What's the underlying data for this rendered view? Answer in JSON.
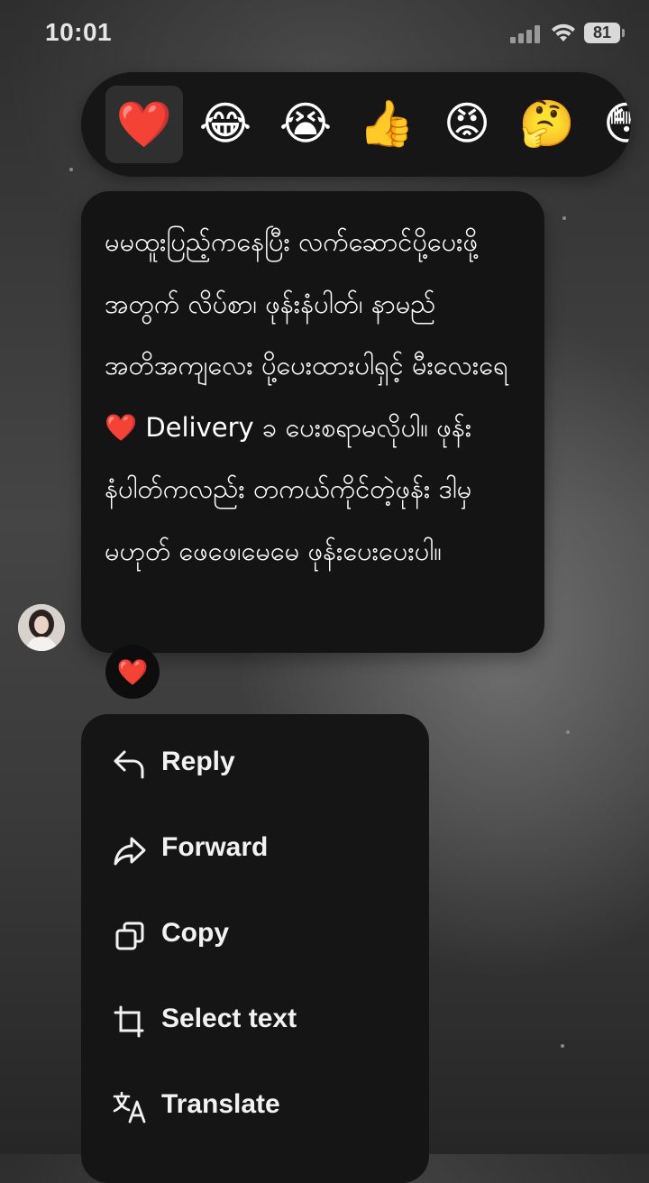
{
  "status_bar": {
    "time": "10:01",
    "battery": "81"
  },
  "reactions": [
    {
      "emoji": "❤️",
      "name": "heart",
      "selected": true
    },
    {
      "emoji": "😂",
      "name": "laughing"
    },
    {
      "emoji": "😭",
      "name": "crying"
    },
    {
      "emoji": "👍",
      "name": "thumbs-up"
    },
    {
      "emoji": "😡",
      "name": "angry"
    },
    {
      "emoji": "🤔",
      "name": "thinking"
    },
    {
      "emoji": "😳",
      "name": "flushed"
    }
  ],
  "message": {
    "text": "မမထူးပြည့်ကနေပြီး လက်ဆောင်ပို့ပေးဖို့အတွက် လိပ်စာ၊ ဖုန်းနံပါတ်၊ နာမည် အတိအကျလေး ပို့ပေးထားပါရှင့် မီးလေးရေ❤️ Delivery ခ ပေးစရာမလိုပါ။ ဖုန်းနံပါတ်ကလည်း တကယ်ကိုင်တဲ့ဖုန်း ဒါမှမဟုတ် ဖေဖေ၊မေမေ ဖုန်းပေးပေးပါ။",
    "reaction": "❤️"
  },
  "menu": {
    "reply": "Reply",
    "forward": "Forward",
    "copy": "Copy",
    "select_text": "Select text",
    "translate": "Translate"
  }
}
